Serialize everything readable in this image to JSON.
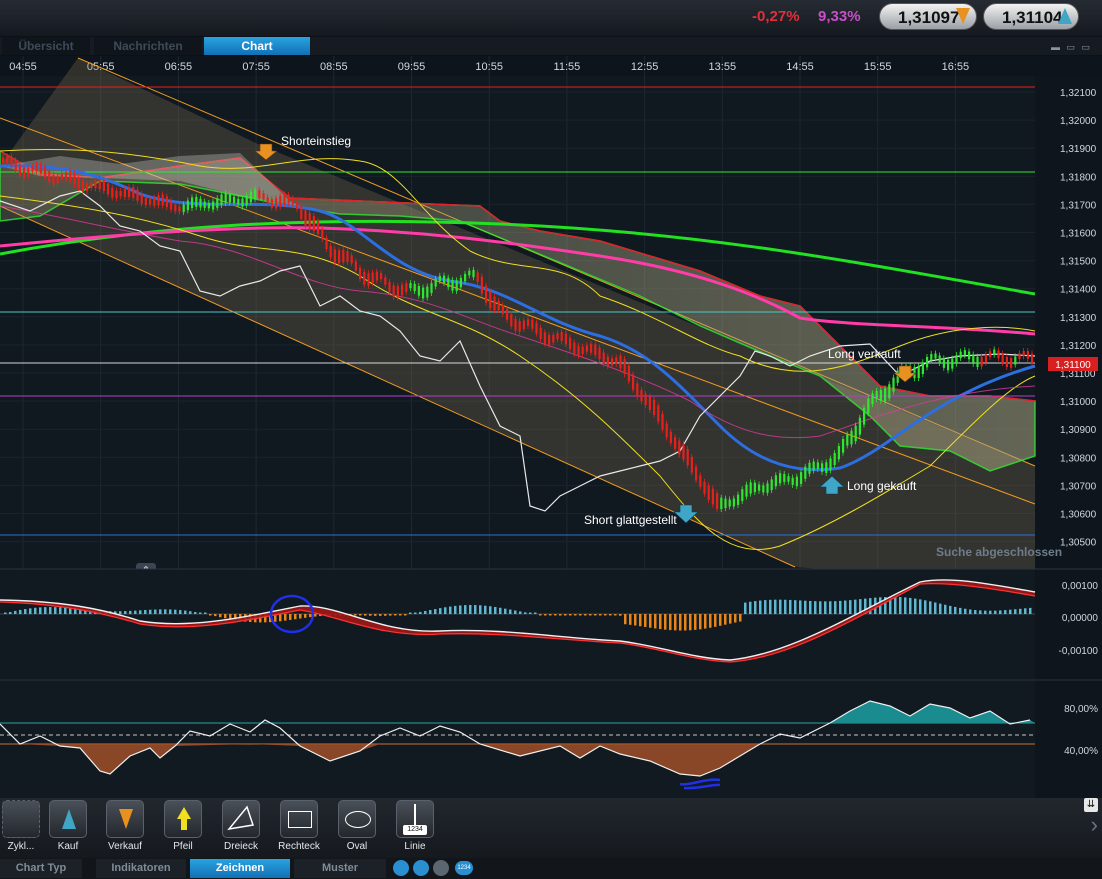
{
  "header": {
    "change_pct": "-0,27%",
    "volatility_pct": "9,33%",
    "sell_price": "1,31097",
    "buy_price": "1,31104"
  },
  "tabs": [
    {
      "label": "Übersicht",
      "active": false
    },
    {
      "label": "Nachrichten",
      "active": false
    },
    {
      "label": "Chart",
      "active": true
    }
  ],
  "chart": {
    "time_labels": [
      "04:55",
      "05:55",
      "06:55",
      "07:55",
      "08:55",
      "09:55",
      "10:55",
      "11:55",
      "12:55",
      "13:55",
      "14:55",
      "15:55",
      "16:55"
    ],
    "price_labels": [
      "1,32100",
      "1,32000",
      "1,31900",
      "1,31800",
      "1,31700",
      "1,31600",
      "1,31500",
      "1,31400",
      "1,31300",
      "1,31200",
      "1,31100",
      "1,31000",
      "1,30900",
      "1,30800",
      "1,30700",
      "1,30600",
      "1,30500"
    ],
    "current_price_tag": "1,31100",
    "annotations": {
      "short_entry": "Shorteinstieg",
      "short_closed": "Short glattgestellt",
      "long_bought": "Long gekauft",
      "long_sold": "Long verkauft"
    },
    "status_text": "Suche abgeschlossen",
    "macd_labels": [
      "0,00100",
      "0,00000",
      "-0,00100"
    ],
    "oscillator_labels": [
      "80,00%",
      "40,00%"
    ],
    "colors": {
      "bull": "#2ee830",
      "bear": "#e8201c",
      "ema_blue": "#2d6fe0",
      "ma_green": "#22e022",
      "ma_magenta": "#ff3ca8",
      "channel": "#f09a20",
      "cloud": "#9c9a80"
    }
  },
  "toolbar": {
    "tools": [
      {
        "label": "Zykl..."
      },
      {
        "label": "Kauf"
      },
      {
        "label": "Verkauf"
      },
      {
        "label": "Pfeil"
      },
      {
        "label": "Dreieck"
      },
      {
        "label": "Rechteck"
      },
      {
        "label": "Oval"
      },
      {
        "label": "Linie"
      }
    ],
    "linie_badge": "1234",
    "bottom_badge": "1234"
  },
  "bottom_tabs": [
    {
      "label": "Chart Typ",
      "active": false
    },
    {
      "label": "Indikatoren",
      "active": false
    },
    {
      "label": "Zeichnen",
      "active": true
    },
    {
      "label": "Muster",
      "active": false
    }
  ]
}
